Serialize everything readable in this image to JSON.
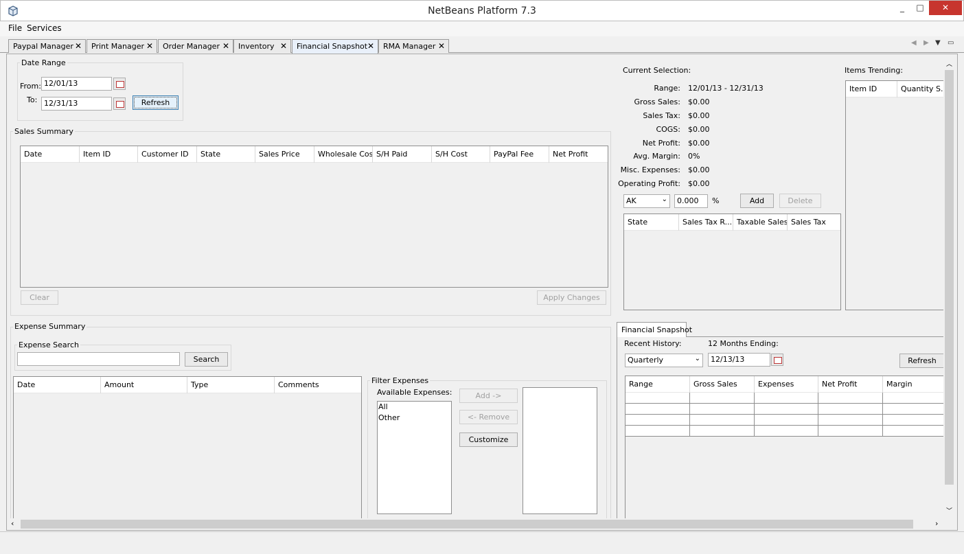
{
  "window": {
    "title": "NetBeans Platform 7.3",
    "minimize": "_",
    "maximize": "□",
    "close": "✕"
  },
  "menu": [
    "File",
    "Services"
  ],
  "tabs": [
    {
      "label": "Paypal Manager"
    },
    {
      "label": "Print Manager"
    },
    {
      "label": "Order Manager"
    },
    {
      "label": "Inventory"
    },
    {
      "label": "Financial Snapshot",
      "active": true
    },
    {
      "label": "RMA Manager"
    }
  ],
  "tab_close": "✕",
  "date_range": {
    "legend": "Date Range",
    "from_label": "From:",
    "from_value": "12/01/13",
    "to_label": "To:",
    "to_value": "12/31/13",
    "refresh": "Refresh"
  },
  "sales_summary": {
    "legend": "Sales Summary",
    "columns": [
      "Date",
      "Item ID",
      "Customer ID",
      "State",
      "Sales Price",
      "Wholesale Cost",
      "S/H Paid",
      "S/H Cost",
      "PayPal Fee",
      "Net Profit"
    ],
    "clear": "Clear",
    "apply": "Apply Changes"
  },
  "current_selection": {
    "title": "Current Selection:",
    "rows": [
      {
        "label": "Range:",
        "value": "12/01/13 - 12/31/13"
      },
      {
        "label": "Gross Sales:",
        "value": "$0.00"
      },
      {
        "label": "Sales Tax:",
        "value": "$0.00"
      },
      {
        "label": "COGS:",
        "value": "$0.00"
      },
      {
        "label": "Net  Profit:",
        "value": "$0.00"
      },
      {
        "label": "Avg. Margin:",
        "value": "0%"
      },
      {
        "label": "Misc. Expenses:",
        "value": "$0.00"
      },
      {
        "label": "Operating  Profit:",
        "value": "$0.00"
      }
    ],
    "state_value": "AK",
    "percent_value": "0.000",
    "percent_sign": "%",
    "add": "Add",
    "delete": "Delete",
    "tax_columns": [
      "State",
      "Sales Tax R...",
      "Taxable Sales",
      "Sales Tax"
    ]
  },
  "items_trending": {
    "title": "Items Trending:",
    "columns": [
      "Item ID",
      "Quantity S..."
    ]
  },
  "expense_summary": {
    "legend": "Expense Summary",
    "search_legend": "Expense Search",
    "search_value": "",
    "search_button": "Search",
    "columns": [
      "Date",
      "Amount",
      "Type",
      "Comments"
    ]
  },
  "filter_expenses": {
    "legend": "Filter Expenses",
    "available_label": "Available Expenses:",
    "available": [
      "All",
      "Other"
    ],
    "add": "Add ->",
    "remove": "<- Remove",
    "customize": "Customize"
  },
  "financial_snapshot": {
    "tab": "Financial Snapshot",
    "recent_history_label": "Recent History:",
    "recent_history_value": "Quarterly",
    "months_label": "12 Months Ending:",
    "months_value": "12/13/13",
    "refresh": "Refresh",
    "columns": [
      "Range",
      "Gross Sales",
      "Expenses",
      "Net Profit",
      "Margin"
    ]
  }
}
